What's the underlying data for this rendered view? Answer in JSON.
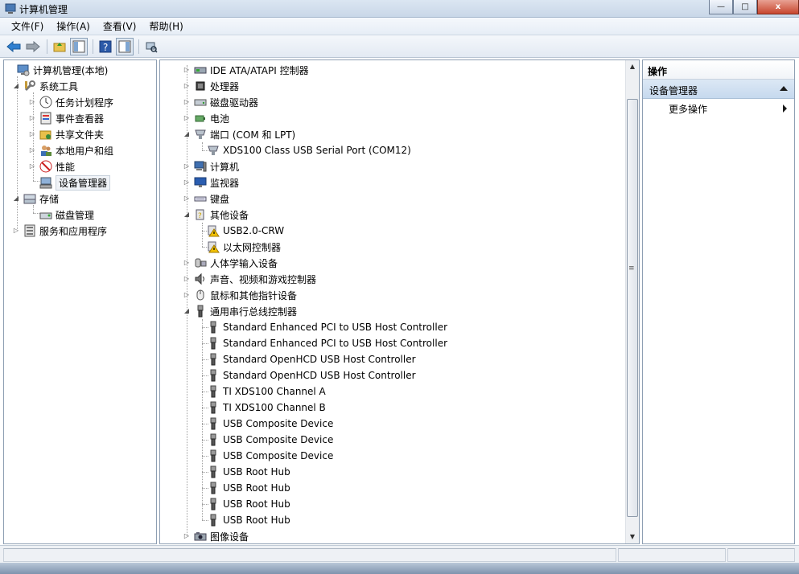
{
  "window": {
    "title": "计算机管理",
    "buttons": {
      "minimize": "—",
      "maximize": "□",
      "close": "x"
    }
  },
  "menubar": [
    {
      "label": "文件(F)"
    },
    {
      "label": "操作(A)"
    },
    {
      "label": "查看(V)"
    },
    {
      "label": "帮助(H)"
    }
  ],
  "toolbar": [
    {
      "icon": "back-arrow-icon"
    },
    {
      "icon": "forward-arrow-icon"
    },
    {
      "icon": "up-folder-icon"
    },
    {
      "icon": "show-hide-console-tree-icon"
    },
    {
      "icon": "help-icon"
    },
    {
      "icon": "show-hide-action-pane-icon"
    },
    {
      "icon": "scan-hardware-icon"
    }
  ],
  "left_tree": [
    {
      "label": "计算机管理(本地)",
      "icon": "computer-management-icon",
      "expander": "none"
    },
    {
      "label": "系统工具",
      "icon": "tools-icon",
      "expander": "expanded"
    },
    {
      "label": "任务计划程序",
      "icon": "clock-icon",
      "expander": "collapsed"
    },
    {
      "label": "事件查看器",
      "icon": "event-viewer-icon",
      "expander": "collapsed"
    },
    {
      "label": "共享文件夹",
      "icon": "shared-folder-icon",
      "expander": "collapsed"
    },
    {
      "label": "本地用户和组",
      "icon": "users-icon",
      "expander": "collapsed"
    },
    {
      "label": "性能",
      "icon": "performance-icon",
      "expander": "collapsed"
    },
    {
      "label": "设备管理器",
      "icon": "device-manager-icon",
      "expander": "none",
      "selected": true
    },
    {
      "label": "存储",
      "icon": "storage-icon",
      "expander": "expanded"
    },
    {
      "label": "磁盘管理",
      "icon": "disk-management-icon",
      "expander": "none"
    },
    {
      "label": "服务和应用程序",
      "icon": "services-icon",
      "expander": "collapsed"
    }
  ],
  "device_tree": [
    {
      "label": "IDE ATA/ATAPI 控制器",
      "icon": "ide-controller-icon",
      "expander": "collapsed"
    },
    {
      "label": "处理器",
      "icon": "processor-icon",
      "expander": "collapsed"
    },
    {
      "label": "磁盘驱动器",
      "icon": "disk-drive-icon",
      "expander": "collapsed"
    },
    {
      "label": "电池",
      "icon": "battery-icon",
      "expander": "collapsed"
    },
    {
      "label": "端口 (COM 和 LPT)",
      "icon": "port-icon",
      "expander": "expanded"
    },
    {
      "label": "XDS100 Class USB Serial Port (COM12)",
      "icon": "port-icon",
      "expander": "none"
    },
    {
      "label": "计算机",
      "icon": "computer-icon",
      "expander": "collapsed"
    },
    {
      "label": "监视器",
      "icon": "monitor-icon",
      "expander": "collapsed"
    },
    {
      "label": "键盘",
      "icon": "keyboard-icon",
      "expander": "collapsed"
    },
    {
      "label": "其他设备",
      "icon": "unknown-device-icon",
      "expander": "expanded"
    },
    {
      "label": "USB2.0-CRW",
      "icon": "warning-device-icon",
      "expander": "none"
    },
    {
      "label": "以太网控制器",
      "icon": "warning-device-icon",
      "expander": "none"
    },
    {
      "label": "人体学输入设备",
      "icon": "hid-icon",
      "expander": "collapsed"
    },
    {
      "label": "声音、视频和游戏控制器",
      "icon": "speaker-icon",
      "expander": "collapsed"
    },
    {
      "label": "鼠标和其他指针设备",
      "icon": "mouse-icon",
      "expander": "collapsed"
    },
    {
      "label": "通用串行总线控制器",
      "icon": "usb-icon",
      "expander": "expanded"
    },
    {
      "label": "Standard Enhanced PCI to USB Host Controller",
      "icon": "usb-icon",
      "expander": "none"
    },
    {
      "label": "Standard Enhanced PCI to USB Host Controller",
      "icon": "usb-icon",
      "expander": "none"
    },
    {
      "label": "Standard OpenHCD USB Host Controller",
      "icon": "usb-icon",
      "expander": "none"
    },
    {
      "label": "Standard OpenHCD USB Host Controller",
      "icon": "usb-icon",
      "expander": "none"
    },
    {
      "label": "TI XDS100 Channel A",
      "icon": "usb-icon",
      "expander": "none"
    },
    {
      "label": "TI XDS100 Channel B",
      "icon": "usb-icon",
      "expander": "none"
    },
    {
      "label": "USB Composite Device",
      "icon": "usb-icon",
      "expander": "none"
    },
    {
      "label": "USB Composite Device",
      "icon": "usb-icon",
      "expander": "none"
    },
    {
      "label": "USB Composite Device",
      "icon": "usb-icon",
      "expander": "none"
    },
    {
      "label": "USB Root Hub",
      "icon": "usb-icon",
      "expander": "none"
    },
    {
      "label": "USB Root Hub",
      "icon": "usb-icon",
      "expander": "none"
    },
    {
      "label": "USB Root Hub",
      "icon": "usb-icon",
      "expander": "none"
    },
    {
      "label": "USB Root Hub",
      "icon": "usb-icon",
      "expander": "none"
    },
    {
      "label": "图像设备",
      "icon": "imaging-device-icon",
      "expander": "collapsed"
    }
  ],
  "actions_pane": {
    "header": "操作",
    "section": "设备管理器",
    "items": [
      {
        "label": "更多操作"
      }
    ]
  },
  "colors": {
    "selection_bg": "#f0f3f7",
    "section_bg": "#c6d9ee",
    "warning": "#f2c200",
    "usb_plug": "#555555"
  }
}
